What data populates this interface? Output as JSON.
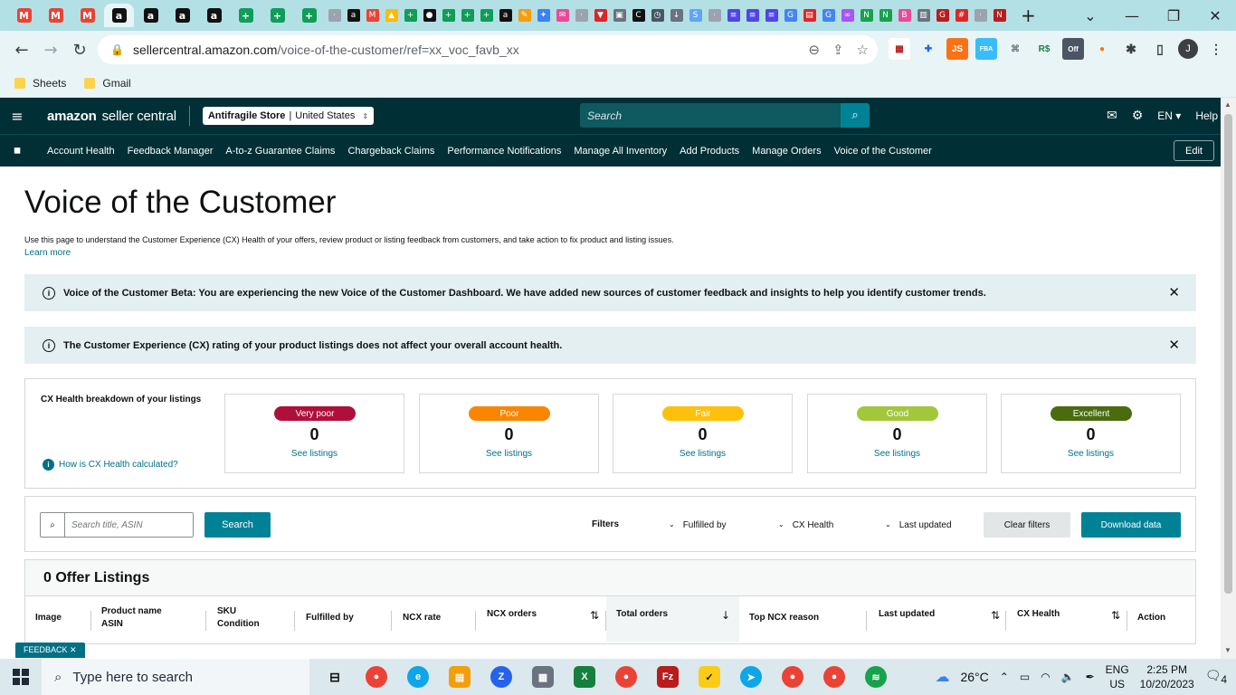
{
  "browser": {
    "address": {
      "lock_icon": "lock-icon",
      "host": "sellercentral.amazon.com",
      "path": "/voice-of-the-customer/ref=xx_voc_favb_xx"
    },
    "bookmarks": [
      {
        "label": "Sheets"
      },
      {
        "label": "Gmail"
      }
    ],
    "extensions": [
      {
        "text": "JS",
        "color": "#f97316",
        "fg": "#ffffff"
      },
      {
        "text": "FBA",
        "color": "#38bdf8",
        "fg": "#ffffff"
      },
      {
        "text": "R$",
        "color": "#ffffff",
        "fg": "#15803d"
      },
      {
        "text": "Off",
        "color": "#4b5563",
        "fg": "#ffffff"
      }
    ],
    "profile_initial": "J"
  },
  "seller_central": {
    "logo": {
      "brand": "amazon",
      "product": "seller central"
    },
    "store": {
      "name": "Antifragile Store",
      "region": "United States"
    },
    "search_placeholder": "Search",
    "lang": "EN",
    "help": "Help",
    "nav_links": [
      "Account Health",
      "Feedback Manager",
      "A-to-z Guarantee Claims",
      "Chargeback Claims",
      "Performance Notifications",
      "Manage All Inventory",
      "Add Products",
      "Manage Orders",
      "Voice of the Customer"
    ],
    "edit_label": "Edit"
  },
  "page": {
    "title": "Voice of the Customer",
    "description": "Use this page to understand the Customer Experience (CX) Health of your offers, review product or listing feedback from customers, and take action to fix product and listing issues.",
    "learn_more": "Learn more",
    "alerts": [
      {
        "text": "Voice of the Customer Beta: You are experiencing the new Voice of the Customer Dashboard. We have added new sources of customer feedback and insights to help you identify customer trends."
      },
      {
        "text": "The Customer Experience (CX) rating of your product listings does not affect your overall account health."
      }
    ],
    "cx_health": {
      "label": "CX Health breakdown of your listings",
      "how_link": "How is CX Health calculated?",
      "ratings": [
        {
          "label": "Very poor",
          "count": "0",
          "link": "See listings",
          "color": "#b00e3b",
          "text_color": "#ffffff"
        },
        {
          "label": "Poor",
          "count": "0",
          "link": "See listings",
          "color": "#fa8500",
          "text_color": "#ffffff"
        },
        {
          "label": "Fair",
          "count": "0",
          "link": "See listings",
          "color": "#fec00b",
          "text_color": "#ffffff"
        },
        {
          "label": "Good",
          "count": "0",
          "link": "See listings",
          "color": "#a2c73b",
          "text_color": "#ffffff"
        },
        {
          "label": "Excellent",
          "count": "0",
          "link": "See listings",
          "color": "#4b6b0f",
          "text_color": "#ffffff"
        }
      ]
    },
    "filters": {
      "search_placeholder": "Search title, ASIN",
      "search_button": "Search",
      "label": "Filters",
      "dropdowns": [
        "Fulfilled by",
        "CX Health",
        "Last updated"
      ],
      "clear_button": "Clear filters",
      "download_button": "Download data"
    },
    "table": {
      "heading": "0 Offer Listings",
      "columns": [
        {
          "line1": "Image",
          "line2": ""
        },
        {
          "line1": "Product name",
          "line2": "ASIN"
        },
        {
          "line1": "SKU",
          "line2": "Condition"
        },
        {
          "line1": "Fulfilled by",
          "line2": ""
        },
        {
          "line1": "NCX rate",
          "line2": ""
        },
        {
          "line1": "NCX orders",
          "line2": ""
        },
        {
          "line1": "Total orders",
          "line2": ""
        },
        {
          "line1": "Top NCX reason",
          "line2": ""
        },
        {
          "line1": "Last updated",
          "line2": ""
        },
        {
          "line1": "CX Health",
          "line2": ""
        },
        {
          "line1": "Action",
          "line2": ""
        }
      ]
    },
    "feedback": "FEEDBACK ✕"
  },
  "taskbar": {
    "search_placeholder": "Type here to search",
    "weather": "26°C",
    "lang_top": "ENG",
    "lang_bottom": "US",
    "time": "2:25 PM",
    "date": "10/20/2023",
    "notifications": "4"
  }
}
